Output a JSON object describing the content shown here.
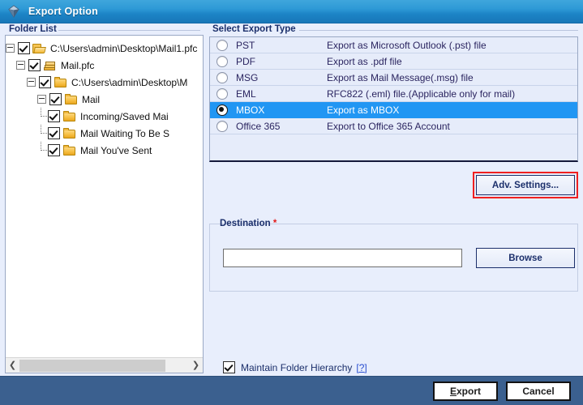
{
  "window": {
    "title": "Export Option",
    "icon": "app-gem-icon"
  },
  "folder_list": {
    "label": "Folder List",
    "items": [
      {
        "label": "C:\\Users\\admin\\Desktop\\Mail1.pfc",
        "depth": 0,
        "checked": true,
        "expanded": true,
        "icon": "folder-open-icon"
      },
      {
        "label": "Mail.pfc",
        "depth": 1,
        "checked": true,
        "expanded": true,
        "icon": "package-icon"
      },
      {
        "label": "C:\\Users\\admin\\Desktop\\M",
        "depth": 2,
        "checked": true,
        "expanded": true,
        "icon": "folder-closed-icon"
      },
      {
        "label": "Mail",
        "depth": 3,
        "checked": true,
        "expanded": true,
        "icon": "folder-closed-icon"
      },
      {
        "label": "Incoming/Saved Mai",
        "depth": 4,
        "checked": true,
        "expanded": false,
        "icon": "folder-closed-icon"
      },
      {
        "label": "Mail Waiting To Be S",
        "depth": 4,
        "checked": true,
        "expanded": false,
        "icon": "folder-closed-icon"
      },
      {
        "label": "Mail You've Sent",
        "depth": 4,
        "checked": true,
        "expanded": false,
        "icon": "folder-closed-icon"
      }
    ],
    "scrollbar": {
      "left_arrow": "❮",
      "right_arrow": "❯"
    }
  },
  "export_type": {
    "label": "Select Export Type",
    "selected": "MBOX",
    "options": [
      {
        "name": "PST",
        "description": "Export as Microsoft Outlook (.pst) file",
        "selected": false
      },
      {
        "name": "PDF",
        "description": "Export as .pdf file",
        "selected": false
      },
      {
        "name": "MSG",
        "description": "Export as Mail Message(.msg) file",
        "selected": false
      },
      {
        "name": "EML",
        "description": "RFC822 (.eml) file.(Applicable only for mail)",
        "selected": false
      },
      {
        "name": "MBOX",
        "description": "Export as MBOX",
        "selected": true
      },
      {
        "name": "Office 365",
        "description": "Export to Office 365 Account",
        "selected": false
      }
    ]
  },
  "advanced": {
    "button_label": "Adv. Settings...",
    "highlight_color": "#ef2020"
  },
  "destination": {
    "label": "Destination",
    "required_marker": "*",
    "input_value": "",
    "input_placeholder": "",
    "browse_label": "Browse"
  },
  "options": {
    "maintain_folder_hierarchy": {
      "label": "Maintain Folder Hierarchy",
      "checked": true,
      "help_link": "[?]"
    }
  },
  "footer": {
    "export_accel": "E",
    "export_rest": "xport",
    "cancel_label": "Cancel"
  },
  "colors": {
    "titlebar": "#2e9ad6",
    "selection": "#2196f3",
    "footer": "#3b608f",
    "body": "#e8eefc",
    "label_text": "#1b2f6b"
  }
}
